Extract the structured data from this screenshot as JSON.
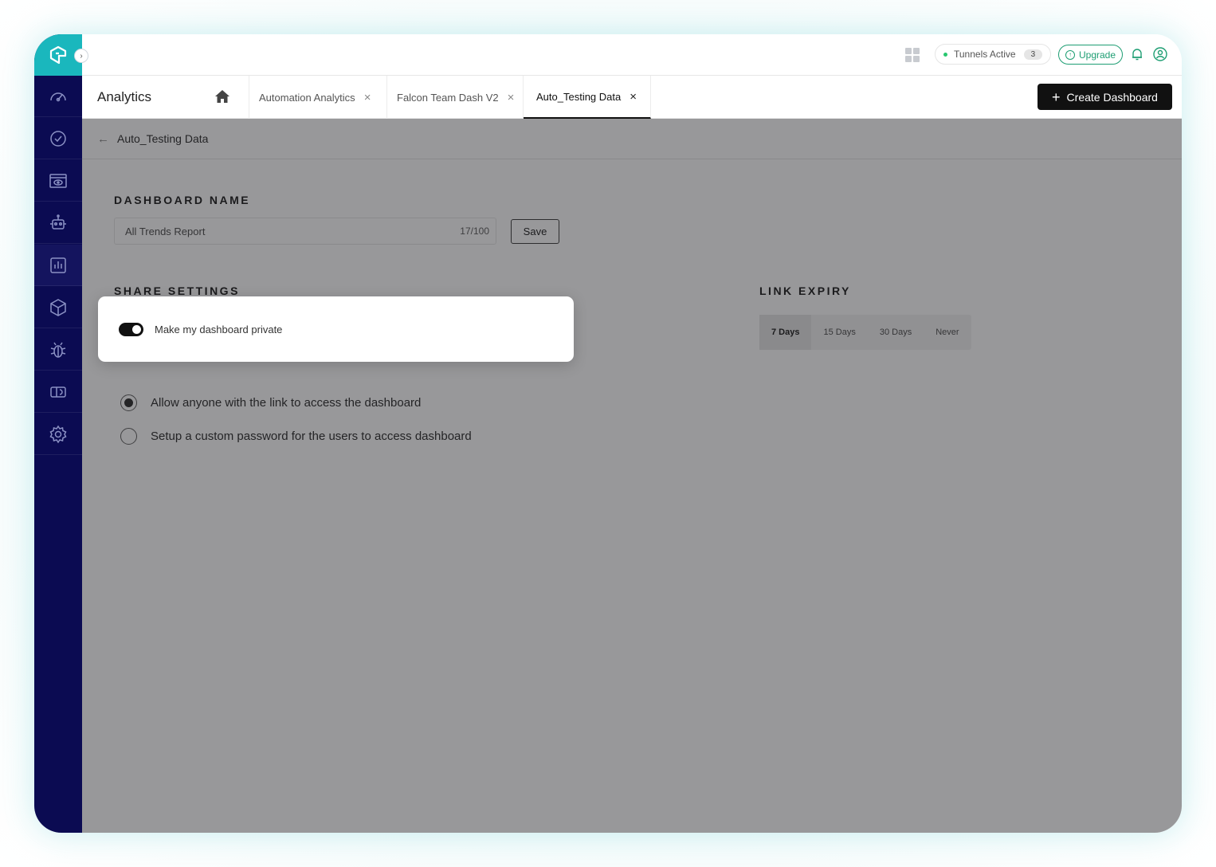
{
  "topbar": {
    "tunnels_label": "Tunnels Active",
    "tunnels_count": "3",
    "upgrade_label": "Upgrade"
  },
  "tabs": {
    "section_label": "Analytics",
    "items": [
      {
        "label": "Automation Analytics"
      },
      {
        "label": "Falcon Team Dash V2"
      },
      {
        "label": "Auto_Testing Data"
      }
    ],
    "create_label": "Create Dashboard"
  },
  "breadcrumb": {
    "title": "Auto_Testing Data"
  },
  "dashboard_name": {
    "heading": "DASHBOARD NAME",
    "value": "All Trends Report",
    "char_count": "17/100",
    "save_label": "Save"
  },
  "share_settings": {
    "heading": "SHARE SETTINGS",
    "private_label": "Make my dashboard private",
    "options": [
      {
        "label": "Allow anyone with the link to access the dashboard",
        "checked": true
      },
      {
        "label": "Setup a custom password for the users to access dashboard",
        "checked": false
      }
    ]
  },
  "link_expiry": {
    "heading": "LINK EXPIRY",
    "options": [
      "7 Days",
      "15 Days",
      "30 Days",
      "Never"
    ],
    "selected": "7 Days"
  },
  "colors": {
    "sidebar": "#0b0b52",
    "brand_teal": "#1ab7bd",
    "upgrade_green": "#1e9e73",
    "primary_button": "#111111"
  },
  "icons": {
    "sidebar": [
      "dashboard-gauge-icon",
      "realtime-clock-icon",
      "visual-eye-icon",
      "automation-robot-icon",
      "analytics-chart-icon",
      "package-box-icon",
      "bug-icon",
      "comparison-icon",
      "settings-gear-icon"
    ]
  }
}
